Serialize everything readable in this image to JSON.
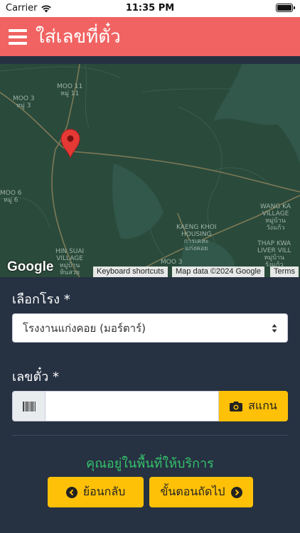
{
  "status_bar": {
    "carrier": "Carrier",
    "time": "11:35 PM",
    "icons": [
      "wifi-icon",
      "battery-icon"
    ]
  },
  "header": {
    "title": "ใส่เลขที่ตั๋ว",
    "menu_icon": "hamburger-menu-icon",
    "background_color": "#f06362"
  },
  "map": {
    "labels": [
      {
        "text": "MOO 3\nหมู่ 3"
      },
      {
        "text": "MOO 11\nหมู่ 11"
      },
      {
        "text": "MOO 6\nหมู่ 6"
      },
      {
        "text": "KAENG KHOI\nHOUSING\nการเคหะ\nแก่งคอย"
      },
      {
        "text": "WANG KA\nVILLAGE\nหมู่บ้าน\nวังแก้ว"
      },
      {
        "text": "THAP KWA\nLIVER VILL\nหมู่บ้าน\nรังแก้ว"
      },
      {
        "text": "HIN SUAI\nVILLAGE\nหมู่บ้าน\nหินสวย"
      },
      {
        "text": "MOO 3"
      }
    ],
    "logo": "Google",
    "attribution": {
      "shortcuts": "Keyboard shortcuts",
      "data": "Map data ©2024 Google",
      "terms": "Terms"
    }
  },
  "form": {
    "plant_label": "เลือกโรง  *",
    "plant_selected": "โรงงานแก่งคอย (มอร์ตาร์)",
    "ticket_label": "เลขตั๋ว  *",
    "ticket_value": "",
    "scan_label": "สแกน",
    "service_status": "คุณอยู่ในพื้นที่ให้บริการ",
    "back_label": "ย้อนกลับ",
    "next_label": "ขั้นตอนถัดไป"
  },
  "colors": {
    "accent": "#ffc107",
    "status_ok": "#34c26a",
    "background": "#263142"
  }
}
